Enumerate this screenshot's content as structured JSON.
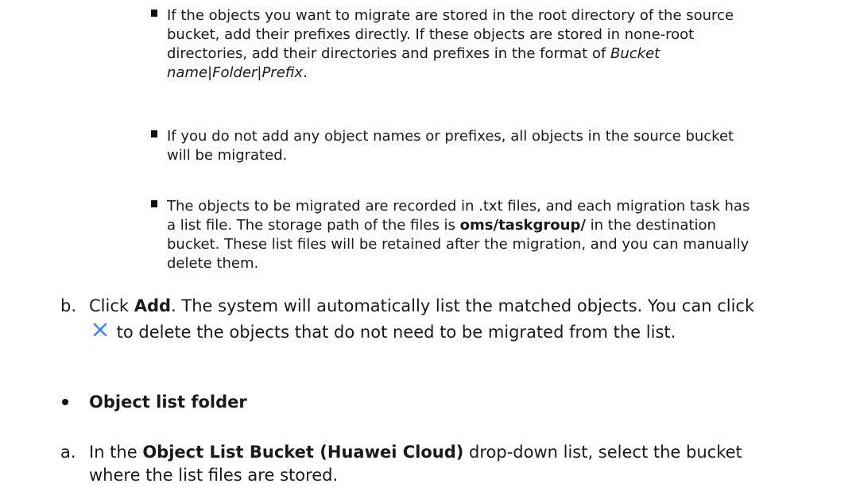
{
  "notes": [
    {
      "pre": "If the objects you want to migrate are stored in the root directory of the source bucket, add their prefixes directly. If these objects are stored in none-root directories, add their directories and prefixes in the format of ",
      "italic": "Bucket name|Folder|Prefix",
      "post": "."
    },
    {
      "text": "If you do not add any object names or prefixes, all objects in the source bucket will be migrated."
    },
    {
      "pre": "The objects to be migrated are recorded in .txt files, and each migration task has a list file. The storage path of the files is ",
      "bold": "oms/taskgroup/",
      "post": " in the destination bucket. These list files will be retained after the migration, and you can manually delete them."
    }
  ],
  "step_b": {
    "label": "b.",
    "pre": "Click ",
    "bold": "Add",
    "mid": ". The system will automatically list the matched objects. You can click ",
    "post": " to delete the objects that do not need to be migrated from the list."
  },
  "bullet": {
    "label": "Object list folder"
  },
  "step_a": {
    "label": "a.",
    "pre": "In the ",
    "bold": "Object List Bucket (Huawei Cloud)",
    "post": " drop-down list, select the bucket where the list files are stored."
  },
  "icons": {
    "delete": "close-icon",
    "delete_color": "#3d8bf2"
  }
}
